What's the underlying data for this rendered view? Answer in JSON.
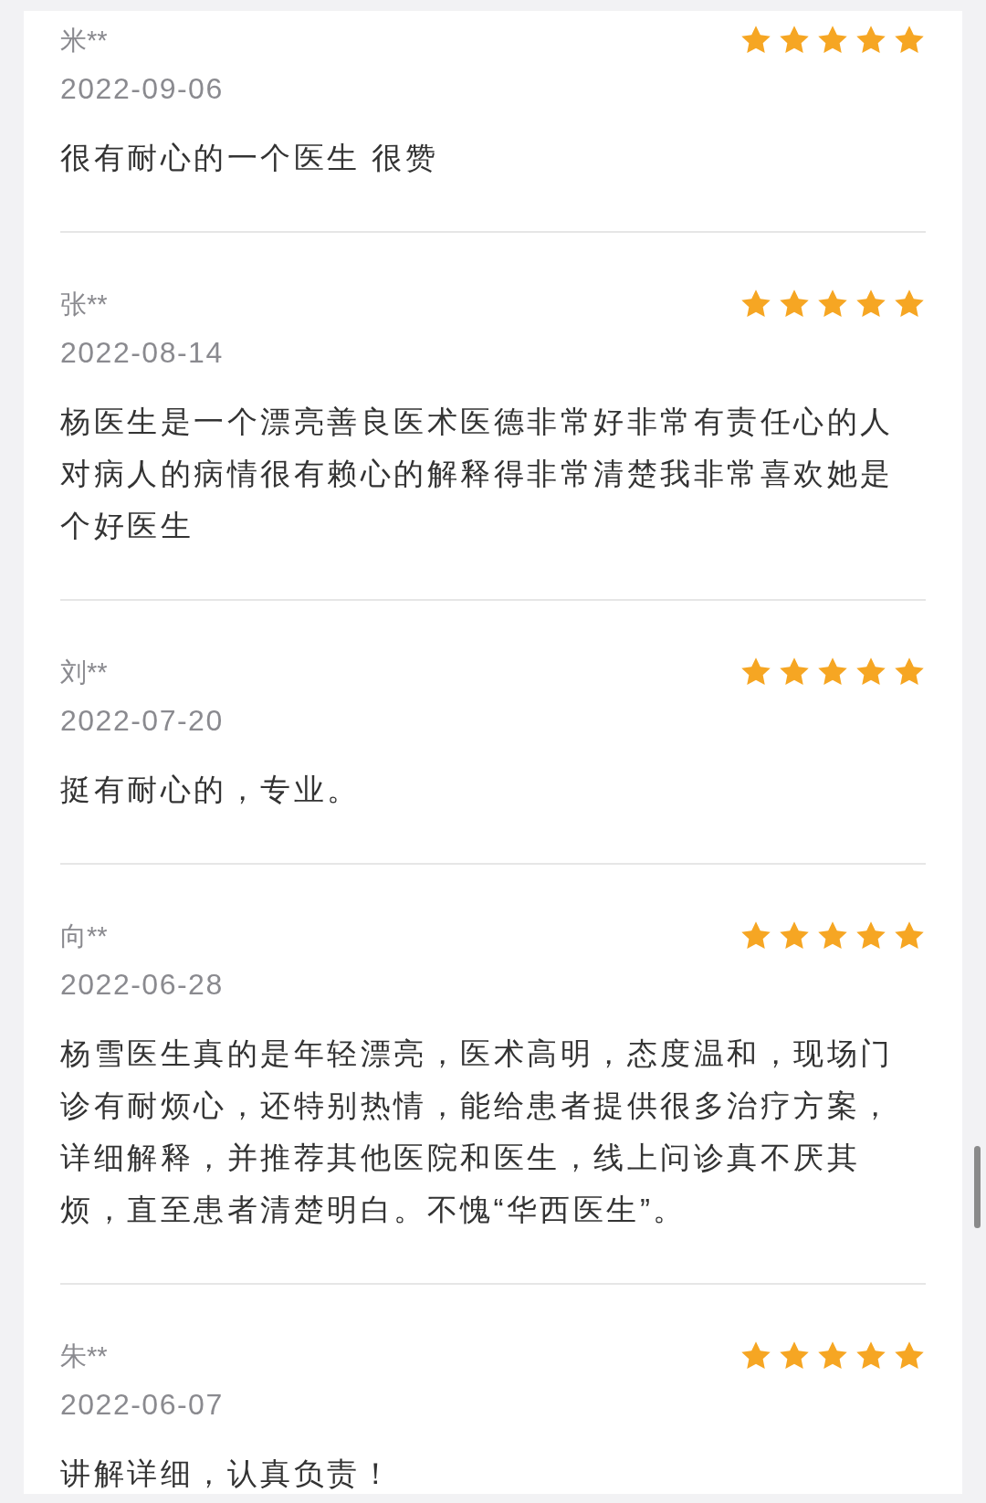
{
  "reviews": [
    {
      "name": "米**",
      "date": "2022-09-06",
      "stars": 5,
      "comment": "很有耐心的一个医生 很赞"
    },
    {
      "name": "张**",
      "date": "2022-08-14",
      "stars": 5,
      "comment": "杨医生是一个漂亮善良医术医德非常好非常有责任心的人对病人的病情很有赖心的解释得非常清楚我非常喜欢她是个好医生"
    },
    {
      "name": "刘**",
      "date": "2022-07-20",
      "stars": 5,
      "comment": "挺有耐心的，专业。"
    },
    {
      "name": "向**",
      "date": "2022-06-28",
      "stars": 5,
      "comment": "杨雪医生真的是年轻漂亮，医术高明，态度温和，现场门诊有耐烦心，还特别热情，能给患者提供很多治疗方案，详细解释，并推荐其他医院和医生，线上问诊真不厌其烦，直至患者清楚明白。不愧“华西医生”。"
    },
    {
      "name": "朱**",
      "date": "2022-06-07",
      "stars": 5,
      "comment": "讲解详细，认真负责！"
    }
  ]
}
